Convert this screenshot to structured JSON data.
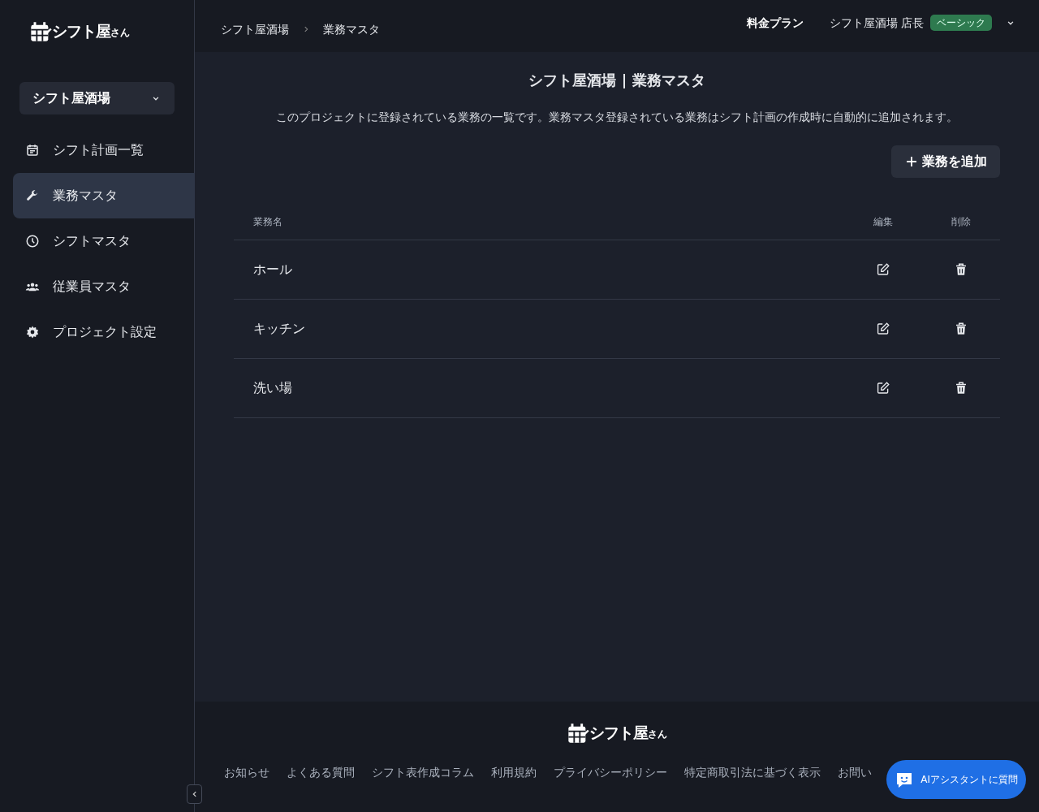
{
  "logo": {
    "name": "シフト屋",
    "suffix": "さん"
  },
  "sidebar": {
    "project": "シフト屋酒場",
    "items": [
      {
        "kind": "calendar",
        "label": "シフト計画一覧",
        "selected": false
      },
      {
        "kind": "wrench",
        "label": "業務マスタ",
        "selected": true
      },
      {
        "kind": "clock",
        "label": "シフトマスタ",
        "selected": false
      },
      {
        "kind": "people",
        "label": "従業員マスタ",
        "selected": false
      },
      {
        "kind": "gear",
        "label": "プロジェクト設定",
        "selected": false
      }
    ]
  },
  "breadcrumb": [
    "シフト屋酒場",
    "業務マスタ"
  ],
  "header": {
    "pricing": "料金プラン",
    "user": "シフト屋酒場 店長",
    "plan_badge": "ベーシック"
  },
  "page": {
    "title": "シフト屋酒場 | 業務マスタ",
    "description": "このプロジェクトに登録されている業務の一覧です。業務マスタ登録されている業務はシフト計画の作成時に自動的に追加されます。",
    "add_button": "業務を追加"
  },
  "table": {
    "columns": [
      "業務名",
      "編集",
      "削除"
    ],
    "rows": [
      {
        "name": "ホール"
      },
      {
        "name": "キッチン"
      },
      {
        "name": "洗い場"
      }
    ]
  },
  "footer": {
    "logo": {
      "name": "シフト屋",
      "suffix": "さん"
    },
    "links": [
      "お知らせ",
      "よくある質問",
      "シフト表作成コラム",
      "利用規約",
      "プライバシーポリシー",
      "特定商取引法に基づく表示",
      "お問い"
    ]
  },
  "assistant_button": "AIアシスタントに質問"
}
